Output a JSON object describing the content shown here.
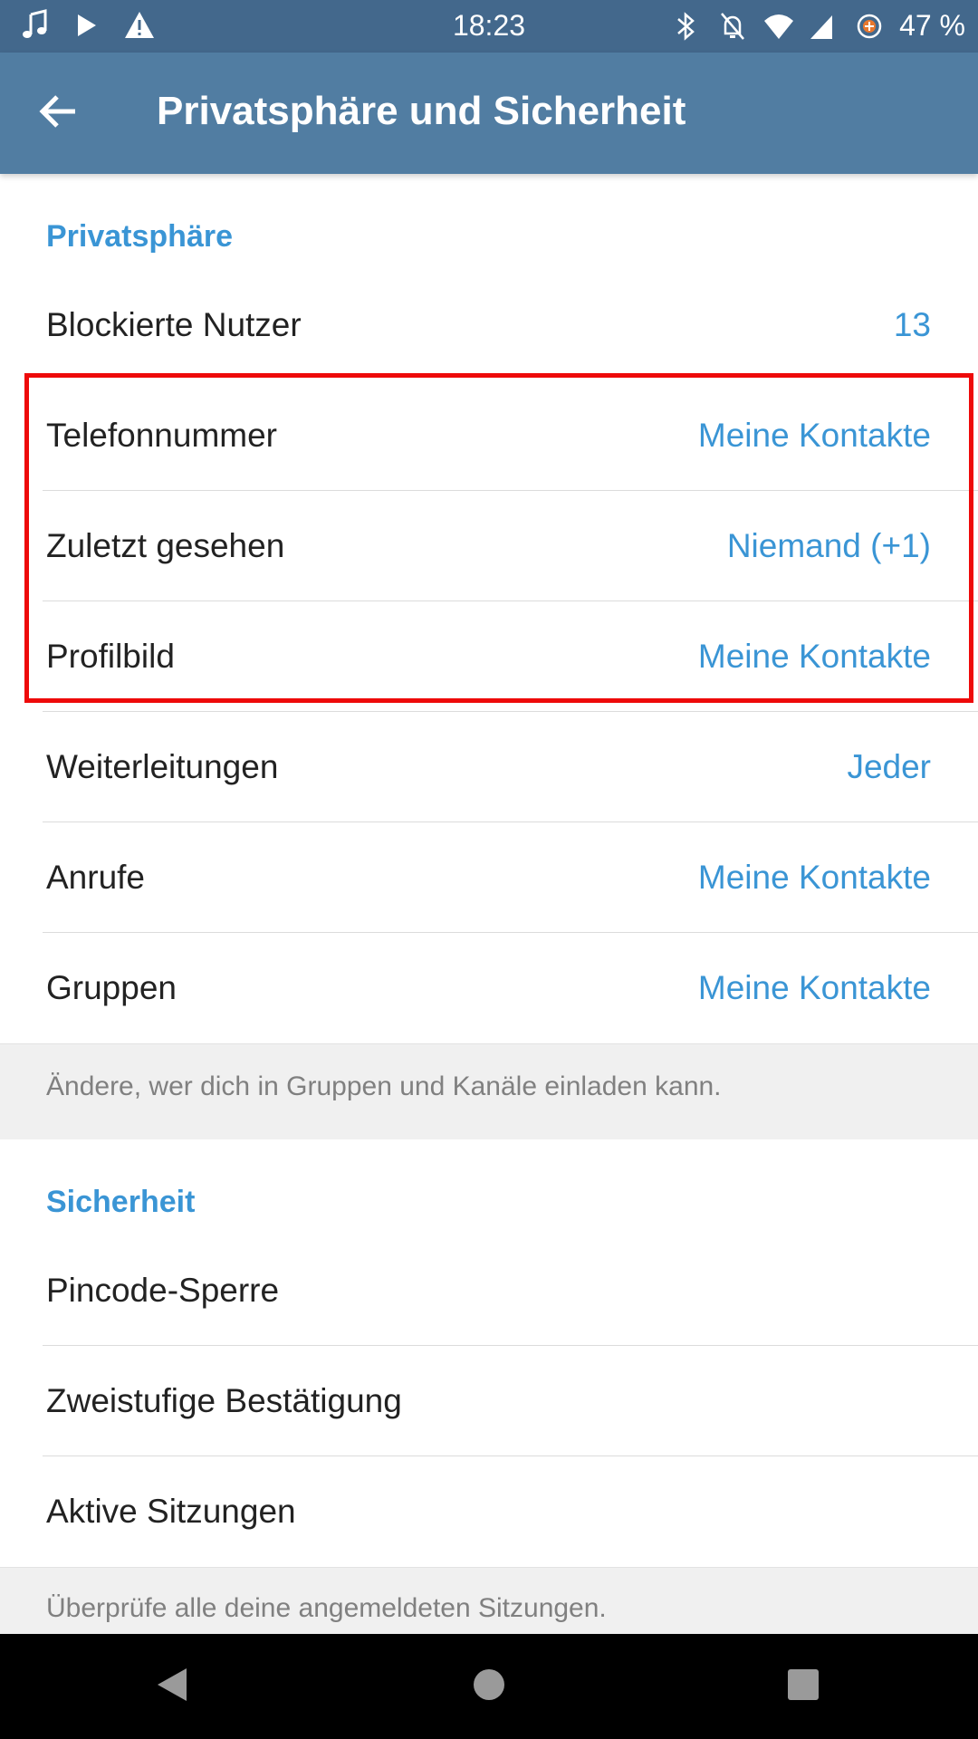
{
  "colors": {
    "statusbar": "#43688c",
    "appbar": "#517da2",
    "accent": "#3a95d5",
    "highlight_border": "#ee0a0a",
    "info_background": "#f0f0f0"
  },
  "statusbar": {
    "time": "18:23",
    "battery": "47 %",
    "left_icons": [
      "music-note-icon",
      "play-icon",
      "warning-icon"
    ],
    "right_icons": [
      "bluetooth-icon",
      "notifications-off-icon",
      "wifi-icon",
      "signal-icon",
      "battery-saver-icon"
    ]
  },
  "appbar": {
    "back_icon": "arrow-back-icon",
    "title": "Privatsphäre und Sicherheit"
  },
  "privacy": {
    "header": "Privatsphäre",
    "rows": [
      {
        "label": "Blockierte Nutzer",
        "value": "13"
      },
      {
        "label": "Telefonnummer",
        "value": "Meine Kontakte"
      },
      {
        "label": "Zuletzt gesehen",
        "value": "Niemand (+1)"
      },
      {
        "label": "Profilbild",
        "value": "Meine Kontakte"
      },
      {
        "label": "Weiterleitungen",
        "value": "Jeder"
      },
      {
        "label": "Anrufe",
        "value": "Meine Kontakte"
      },
      {
        "label": "Gruppen",
        "value": "Meine Kontakte"
      }
    ],
    "info": "Ändere, wer dich in Gruppen und Kanäle einladen kann."
  },
  "security": {
    "header": "Sicherheit",
    "rows": [
      {
        "label": "Pincode-Sperre"
      },
      {
        "label": "Zweistufige Bestätigung"
      },
      {
        "label": "Aktive Sitzungen"
      }
    ],
    "info": "Überprüfe alle deine angemeldeten Sitzungen."
  },
  "navbar": {
    "icons": [
      "nav-back-icon",
      "nav-home-icon",
      "nav-recents-icon"
    ]
  }
}
